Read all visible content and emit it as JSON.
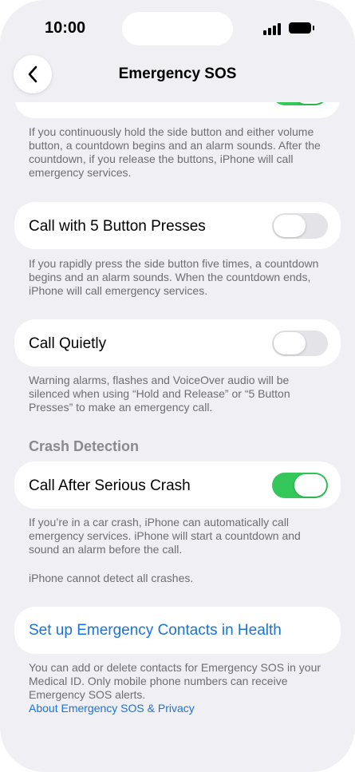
{
  "status_bar": {
    "time": "10:00"
  },
  "nav": {
    "title": "Emergency SOS"
  },
  "hold_release": {
    "toggle_on": true,
    "footnote": "If you continuously hold the side button and either volume button, a countdown begins and an alarm sounds. After the countdown, if you release the buttons, iPhone will call emergency services."
  },
  "five_presses": {
    "label": "Call with 5 Button Presses",
    "toggle_on": false,
    "footnote": "If you rapidly press the side button five times, a countdown begins and an alarm sounds. When the countdown ends, iPhone will call emergency services."
  },
  "call_quietly": {
    "label": "Call Quietly",
    "toggle_on": false,
    "footnote": "Warning alarms, flashes and VoiceOver audio will be silenced when using “Hold and Release” or “5 Button Presses” to make an emergency call."
  },
  "crash_detection": {
    "header": "Crash Detection",
    "label": "Call After Serious Crash",
    "toggle_on": true,
    "footnote": "If you’re in a car crash, iPhone can automatically call emergency services. iPhone will start a countdown and sound an alarm before the call.",
    "footnote2": "iPhone cannot detect all crashes."
  },
  "emergency_contacts": {
    "link_label": "Set up Emergency Contacts in Health",
    "footnote": "You can add or delete contacts for Emergency SOS in your Medical ID. Only mobile phone numbers can receive Emergency SOS alerts.",
    "privacy_link": "About Emergency SOS & Privacy"
  },
  "colors": {
    "background": "#efeff4",
    "toggle_on": "#34c759",
    "toggle_off": "#e3e3e8",
    "link": "#1a73d9",
    "footnote": "#6d6d72"
  }
}
